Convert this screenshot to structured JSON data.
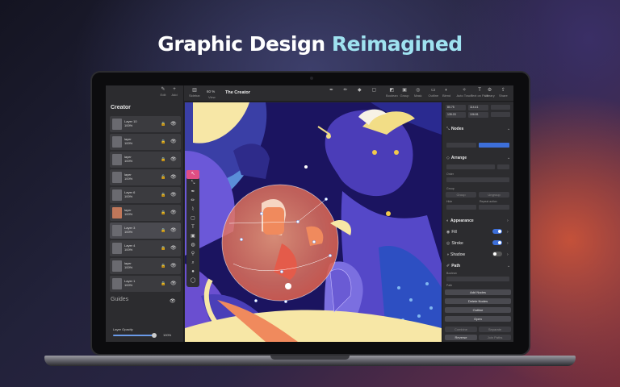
{
  "headline": {
    "main": "Graphic Design",
    "accent": "Reimagined"
  },
  "left_panel": {
    "tools": [
      {
        "icon": "pen-icon",
        "label": "Edit"
      },
      {
        "icon": "plus-icon",
        "label": "Add"
      }
    ],
    "title": "Creator",
    "layers": [
      {
        "name": "Layer 10",
        "opacity": "100%",
        "thumb": "gray",
        "locked": true,
        "selected": false
      },
      {
        "name": "layer",
        "opacity": "100%",
        "thumb": "gray",
        "locked": true,
        "selected": false
      },
      {
        "name": "layer",
        "opacity": "100%",
        "thumb": "gray",
        "locked": true,
        "selected": false
      },
      {
        "name": "layer",
        "opacity": "100%",
        "thumb": "gray",
        "locked": false,
        "selected": false
      },
      {
        "name": "Layer 6",
        "opacity": "100%",
        "thumb": "gray",
        "locked": true,
        "selected": false
      },
      {
        "name": "layer",
        "opacity": "100%",
        "thumb": "orange",
        "locked": true,
        "selected": false
      },
      {
        "name": "Layer 3",
        "opacity": "100%",
        "thumb": "gray",
        "locked": true,
        "selected": true
      },
      {
        "name": "Layer 4",
        "opacity": "100%",
        "thumb": "gray",
        "locked": true,
        "selected": false
      },
      {
        "name": "layer",
        "opacity": "100%",
        "thumb": "gray",
        "locked": true,
        "selected": false
      },
      {
        "name": "Layer 1",
        "opacity": "100%",
        "thumb": "gray",
        "locked": true,
        "selected": false
      }
    ],
    "guides_label": "Guides",
    "opacity_label": "Layer Opacity",
    "opacity_value": "100%",
    "opacity_fraction": 0.92
  },
  "toolbar": {
    "left": [
      {
        "icon": "sidebar-icon",
        "label": "Sidebar"
      }
    ],
    "zoom": "60 %",
    "view_label": "View",
    "document_title": "The Creator",
    "right": [
      {
        "icon": "pen-tool-icon",
        "label": ""
      },
      {
        "icon": "pencil-icon",
        "label": ""
      },
      {
        "icon": "node-icon",
        "label": ""
      },
      {
        "icon": "shape-icon",
        "label": ""
      },
      {
        "icon": "boolean-icon",
        "label": "Boolean"
      },
      {
        "icon": "group-icon",
        "label": "Group"
      },
      {
        "icon": "mask-icon",
        "label": "Mask"
      },
      {
        "icon": "outline-icon",
        "label": "Outline"
      },
      {
        "icon": "blend-icon",
        "label": "Blend"
      },
      {
        "icon": "auto-trace-icon",
        "label": "Auto Trace"
      },
      {
        "icon": "text-on-path-icon",
        "label": "Text on Path"
      },
      {
        "icon": "gear-icon",
        "label": "Library"
      },
      {
        "icon": "share-icon",
        "label": "Share"
      }
    ]
  },
  "inspector": {
    "x": "80.75",
    "y": "114.41",
    "w": "139.03",
    "h": "106.81",
    "nodes_label": "Nodes",
    "arrange_label": "Arrange",
    "order_label": "Order",
    "group_label": "Group",
    "group_btns": [
      "Group",
      "Ungroup"
    ],
    "hide_label": "Hide",
    "repeat_label": "Repeat action",
    "appearance_label": "Appearance",
    "fill_label": "Fill",
    "stroke_label": "Stroke",
    "shadow_label": "Shadow",
    "path_label": "Path",
    "boolean_label": "Boolean",
    "path_sub_label": "Path",
    "buttons": [
      "Add Nodes",
      "Delete Nodes",
      "Outline",
      "Open"
    ],
    "bottom_buttons": [
      [
        "Combine",
        "Separate"
      ],
      [
        "Reverse",
        "Join Paths"
      ]
    ]
  },
  "colors": {
    "accent": "#9fe2f0",
    "toggle": "#3d6fd9",
    "tool_active": "#e04e84",
    "canvas_purple": "#5b4bc9"
  }
}
